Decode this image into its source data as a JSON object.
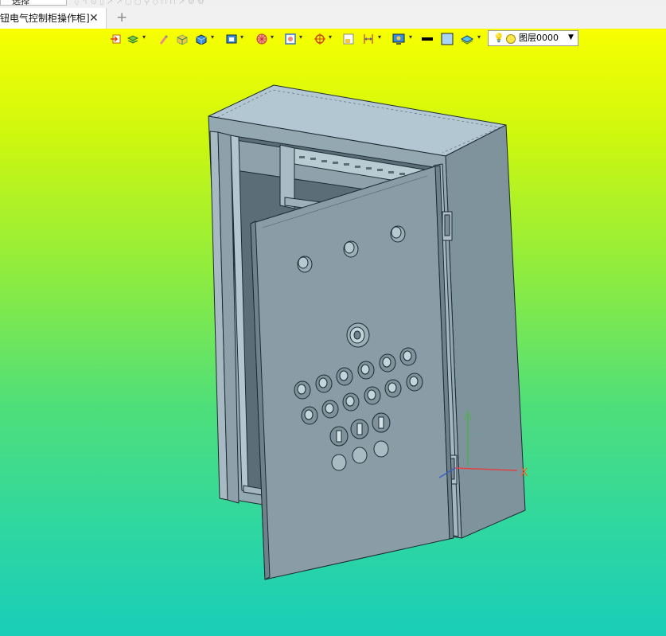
{
  "top_toolbar": {
    "select_value": "选择"
  },
  "tab": {
    "title": "钮电气控制柜操作柜]",
    "close_glyph": "✕",
    "add_glyph": "+"
  },
  "toolbar": {
    "icons": [
      "exit-icon",
      "layers-icon",
      "brush-icon",
      "box-icon",
      "solid-cube-icon",
      "render-mode-icon",
      "sphere-icon",
      "frame-icon",
      "snap-icon",
      "window-icon",
      "dimension-icon",
      "display-icon",
      "line-color-icon",
      "fill-color-icon",
      "surface-icon"
    ],
    "line_color": "#000000",
    "fill_color": "#aad4f4"
  },
  "layer": {
    "name": "图层0000"
  },
  "axis": {
    "x_label": "X"
  },
  "colors": {
    "viewport_top": "#f8ff00",
    "viewport_bottom": "#19cdb8",
    "metal": "#8a9ca5",
    "metal_dark": "#6f828c",
    "edge": "#1c2b33"
  }
}
